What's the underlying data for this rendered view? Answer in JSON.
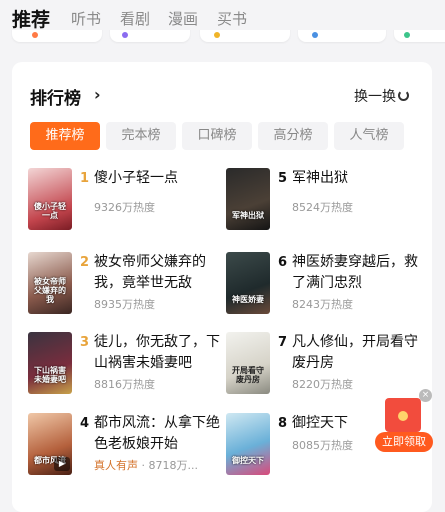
{
  "top_tabs": [
    {
      "label": "推荐",
      "active": true
    },
    {
      "label": "听书",
      "active": false
    },
    {
      "label": "看剧",
      "active": false
    },
    {
      "label": "漫画",
      "active": false
    },
    {
      "label": "买书",
      "active": false
    }
  ],
  "ranking": {
    "title": "排行榜",
    "refresh_label": "换一换",
    "tabs": [
      {
        "label": "推荐榜",
        "active": true
      },
      {
        "label": "完本榜",
        "active": false
      },
      {
        "label": "口碑榜",
        "active": false
      },
      {
        "label": "高分榜",
        "active": false
      },
      {
        "label": "人气榜",
        "active": false
      }
    ],
    "books": [
      {
        "rank": "1",
        "title": "傻小子轻一点",
        "heat": "9326万热度",
        "cover_text": "傻小子轻一点"
      },
      {
        "rank": "2",
        "title": "被女帝师父嫌弃的我，竟举世无敌",
        "heat": "8935万热度",
        "cover_text": "被女帝师父嫌弃的我"
      },
      {
        "rank": "3",
        "title": "徒儿，你无敌了，下山祸害未婚妻吧",
        "heat": "8816万热度",
        "cover_text": "下山祸害未婚妻吧"
      },
      {
        "rank": "4",
        "title": "都市风流：从拿下绝色老板娘开始",
        "heat": "8718万...",
        "tag": "真人有声",
        "cover_text": "都市风流"
      },
      {
        "rank": "5",
        "title": "军神出狱",
        "heat": "8524万热度",
        "cover_text": "军神出狱"
      },
      {
        "rank": "6",
        "title": "神医娇妻穿越后，救了满门忠烈",
        "heat": "8243万热度",
        "cover_text": "神医娇妻"
      },
      {
        "rank": "7",
        "title": "凡人修仙，开局看守废丹房",
        "heat": "8220万热度",
        "cover_text": "开局看守废丹房"
      },
      {
        "rank": "8",
        "title": "御控天下",
        "heat": "8085万热度",
        "cover_text": "御控天下"
      }
    ]
  },
  "promo": {
    "cta": "立即领取"
  },
  "colors": {
    "accent": "#ff6b1a",
    "rank_top": "#e8a43c",
    "rank_other": "#111111"
  }
}
